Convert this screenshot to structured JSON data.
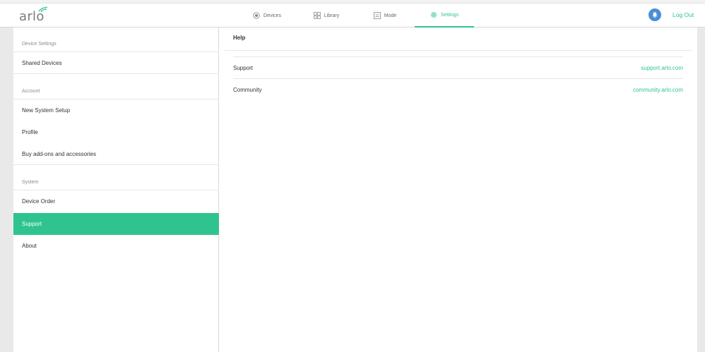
{
  "brand": {
    "logo_text": "arlo",
    "accent_color": "#2fc48f",
    "avatar_color": "#4a8fd6"
  },
  "nav": {
    "items": [
      {
        "label": "Devices",
        "icon": "devices-icon"
      },
      {
        "label": "Library",
        "icon": "library-grid-icon"
      },
      {
        "label": "Mode",
        "icon": "mode-icon"
      },
      {
        "label": "Settings",
        "icon": "gear-icon",
        "active": true
      }
    ],
    "logout_label": "Log Out"
  },
  "sidebar": {
    "sections": [
      {
        "heading": "Device Settings",
        "items": [
          "Shared Devices"
        ]
      },
      {
        "heading": "Account",
        "items": [
          "New System Setup",
          "Profile",
          "Buy add-ons and accessories"
        ]
      },
      {
        "heading": "System",
        "items": [
          "Device Order",
          "Support",
          "About"
        ]
      }
    ],
    "active_item": "Support"
  },
  "main": {
    "title": "Help",
    "rows": [
      {
        "label": "Support",
        "link": "support.arlo.com"
      },
      {
        "label": "Community",
        "link": "community.arlo.com"
      }
    ]
  }
}
